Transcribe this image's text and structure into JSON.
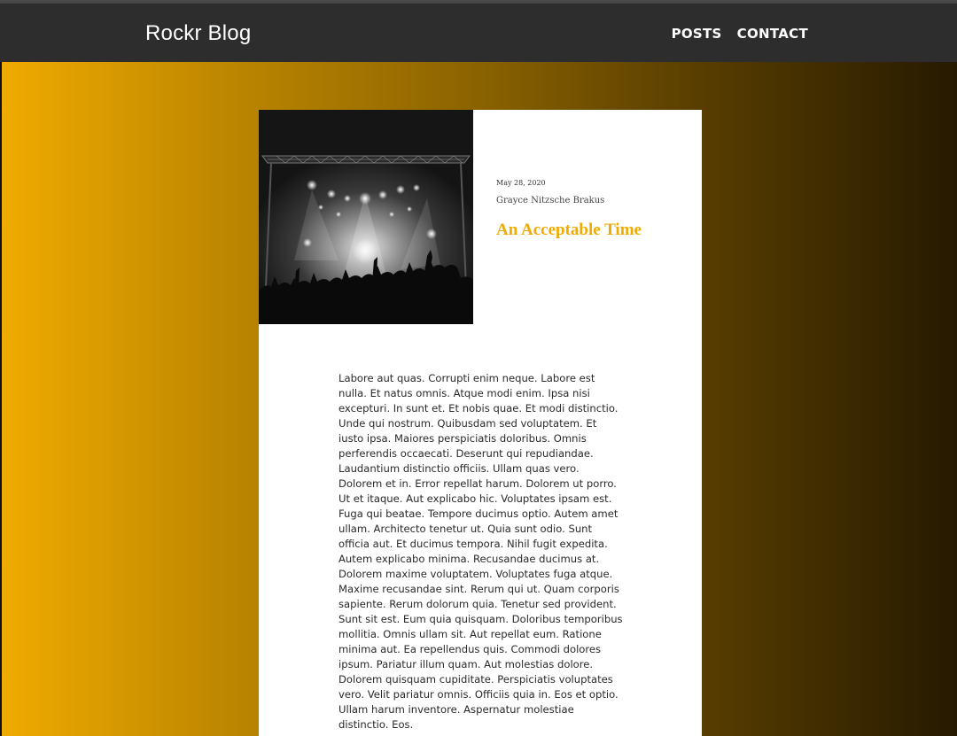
{
  "navbar": {
    "brand": "Rockr Blog",
    "links": [
      {
        "label": "POSTS"
      },
      {
        "label": "CONTACT"
      }
    ]
  },
  "post": {
    "image_alt": "concert crowd",
    "date": "May 28, 2020",
    "author": "Grayce Nitzsche Brakus",
    "title": "An Acceptable Time",
    "body": "Labore aut quas. Corrupti enim neque. Labore est nulla. Et natus omnis. Atque modi enim. Ipsa nisi excepturi. In sunt et. Et nobis quae. Et modi distinctio. Unde qui nostrum. Quibusdam sed voluptatem. Et iusto ipsa. Maiores perspiciatis doloribus. Omnis perferendis occaecati. Deserunt qui repudiandae. Laudantium distinctio officiis. Ullam quas vero. Dolorem et in. Error repellat harum. Dolorem ut porro. Ut et itaque. Aut explicabo hic. Voluptates ipsam est. Fuga qui beatae. Tempore ducimus optio. Autem amet ullam. Architecto tenetur ut. Quia sunt odio. Sunt officia aut. Et ducimus tempora. Nihil fugit expedita. Autem explicabo minima. Recusandae ducimus at. Dolorem maxime voluptatem. Voluptates fuga atque. Maxime recusandae sint. Rerum qui ut. Quam corporis sapiente. Rerum dolorum quia. Tenetur sed provident. Sunt sit est. Eum quia quisquam. Doloribus temporibus mollitia. Omnis ullam sit. Aut repellat eum. Ratione minima aut. Ea repellendus quis. Commodi dolores ipsum. Pariatur illum quam. Aut molestias dolore. Dolorem quisquam cupiditate. Perspiciatis voluptates vero. Velit pariatur omnis. Officiis quia in. Eos et optio. Ullam harum inventore. Aspernatur molestiae distinctio. Eos."
  },
  "colors": {
    "accent": "#f0ab00",
    "navbar": "#2d2d2d",
    "gradient_start": "#f0ab00",
    "gradient_end": "#261a00"
  }
}
